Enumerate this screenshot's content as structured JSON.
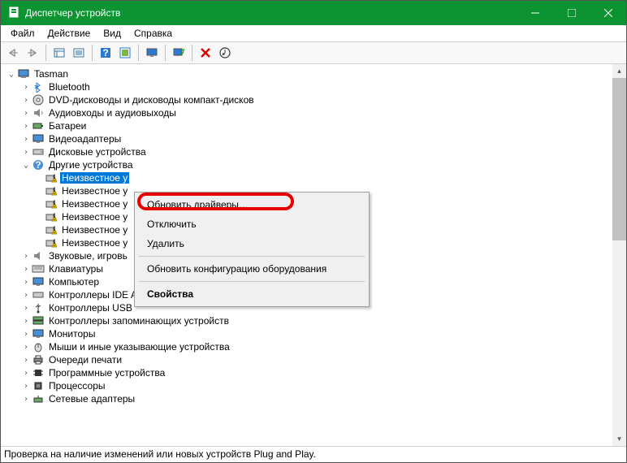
{
  "window": {
    "title": "Диспетчер устройств"
  },
  "menu": {
    "file": "Файл",
    "action": "Действие",
    "view": "Вид",
    "help": "Справка"
  },
  "tree": {
    "root": "Tasman",
    "bluetooth": "Bluetooth",
    "dvd": "DVD-дисководы и дисководы компакт-дисков",
    "audio": "Аудиовходы и аудиовыходы",
    "battery": "Батареи",
    "video": "Видеоадаптеры",
    "disk": "Дисковые устройства",
    "other": "Другие устройства",
    "unknown1": "Неизвестное у",
    "unknown2": "Неизвестное у",
    "unknown3": "Неизвестное у",
    "unknown4": "Неизвестное у",
    "unknown5": "Неизвестное у",
    "unknown6": "Неизвестное у",
    "sound": "Звуковые, игровь",
    "keyboard": "Клавиатуры",
    "computer": "Компьютер",
    "ide": "Контроллеры IDE ATA/ATAPI",
    "usb": "Контроллеры USB",
    "storage": "Контроллеры запоминающих устройств",
    "monitor": "Мониторы",
    "mouse": "Мыши и иные указывающие устройства",
    "printq": "Очереди печати",
    "software": "Программные устройства",
    "cpu": "Процессоры",
    "net": "Сетевые адаптеры"
  },
  "context": {
    "update": "Обновить драйверы…",
    "disable": "Отключить",
    "delete": "Удалить",
    "refresh": "Обновить конфигурацию оборудования",
    "properties": "Свойства"
  },
  "status": "Проверка на наличие изменений или новых устройств Plug and Play."
}
